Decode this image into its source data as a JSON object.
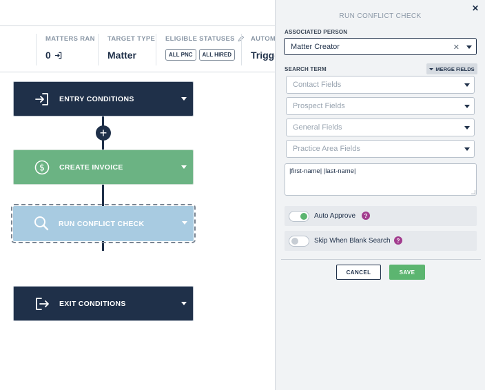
{
  "stats": {
    "matters_ran_label": "MATTERS RAN",
    "matters_ran_value": "0",
    "target_type_label": "TARGET TYPE",
    "target_type_value": "Matter",
    "eligible_statuses_label": "ELIGIBLE STATUSES",
    "eligible_statuses": [
      "ALL PNC",
      "ALL HIRED"
    ],
    "automation_label": "AUTOMA",
    "automation_value": "Trigge"
  },
  "workflow": {
    "nodes": [
      {
        "label": "ENTRY CONDITIONS",
        "icon": "sign-in-icon"
      },
      {
        "label": "CREATE INVOICE",
        "icon": "dollar-circle-icon"
      },
      {
        "label": "RUN CONFLICT CHECK",
        "icon": "search-icon"
      },
      {
        "label": "EXIT CONDITIONS",
        "icon": "sign-out-icon"
      }
    ]
  },
  "panel": {
    "title": "RUN CONFLICT CHECK",
    "associated_person_label": "ASSOCIATED PERSON",
    "associated_person_value": "Matter Creator",
    "search_term_label": "SEARCH TERM",
    "merge_fields_label": "MERGE FIELDS",
    "merge_dropdowns": [
      "Contact Fields",
      "Prospect Fields",
      "General Fields",
      "Practice Area Fields"
    ],
    "search_term_value": "|first-name| |last-name|",
    "toggles": [
      {
        "label": "Auto Approve",
        "on": true
      },
      {
        "label": "Skip When Blank Search",
        "on": false
      }
    ],
    "cancel_label": "CANCEL",
    "save_label": "SAVE"
  },
  "colors": {
    "navy": "#1f3049",
    "green": "#6bb383",
    "light_blue": "#a8cbe1",
    "accent_green": "#5cb570",
    "help_purple": "#a23d8e"
  }
}
